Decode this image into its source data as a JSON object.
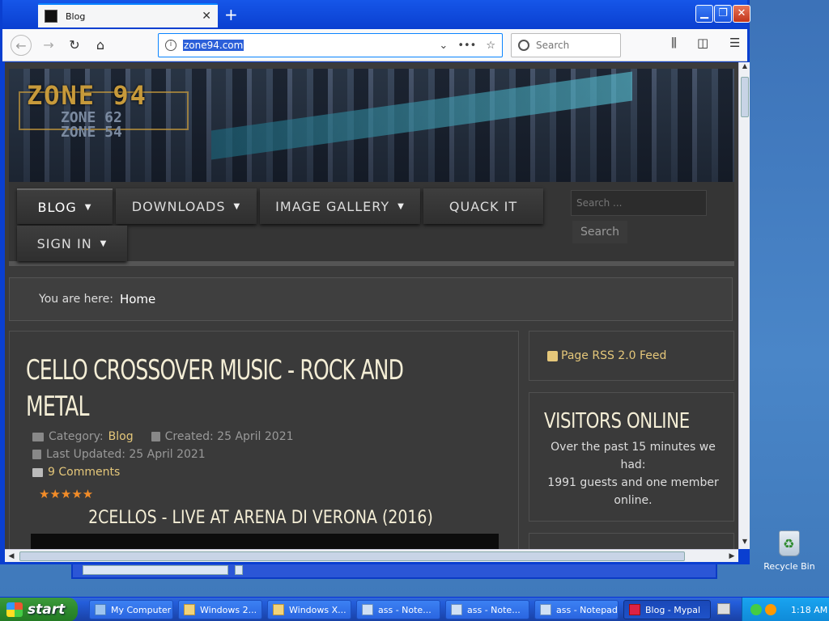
{
  "browser": {
    "tab_title": "Blog",
    "url": "zone94.com",
    "search_placeholder": "Search"
  },
  "site": {
    "logo_main": "ZONE 94",
    "logo_sub1": "ZONE 62",
    "logo_sub2": "ZONE 54",
    "menu": [
      {
        "label": "BLOG",
        "caret": "▼"
      },
      {
        "label": "DOWNLOADS",
        "caret": "▼"
      },
      {
        "label": "IMAGE GALLERY",
        "caret": "▼"
      },
      {
        "label": "QUACK IT",
        "caret": ""
      },
      {
        "label": "SIGN IN",
        "caret": "▼"
      }
    ],
    "search_placeholder": "Search ...",
    "search_button": "Search",
    "breadcrumb_prefix": "You are here:",
    "breadcrumb_home": "Home"
  },
  "article": {
    "title": "CELLO CROSSOVER MUSIC - ROCK AND METAL",
    "category_label": "Category:",
    "category": "Blog",
    "created": "Created: 25 April 2021",
    "updated": "Last Updated: 25 April 2021",
    "comments": "9 Comments",
    "stars": "★★★★★",
    "subtitle": "2CELLOS - LIVE AT ARENA DI VERONA (2016)"
  },
  "sidebar": {
    "rss": "Page RSS 2.0 Feed",
    "visitors_title": "VISITORS ONLINE",
    "visitors_text_1": "Over the past 15 minutes we had:",
    "visitors_text_2": "1991 guests and one member online."
  },
  "desktop": {
    "recycle_bin": "Recycle Bin"
  },
  "taskbar": {
    "start": "start",
    "items": [
      {
        "label": "My Computer"
      },
      {
        "label": "Windows 2..."
      },
      {
        "label": "Windows X..."
      },
      {
        "label": "ass - Note..."
      },
      {
        "label": "ass - Note..."
      },
      {
        "label": "ass - Notepad"
      },
      {
        "label": "Blog - Mypal"
      }
    ],
    "clock": "1:18 AM"
  },
  "colors": {
    "accent_gold": "#e5c77a",
    "star_orange": "#f28c28",
    "xp_blue": "#0a3fd0"
  }
}
